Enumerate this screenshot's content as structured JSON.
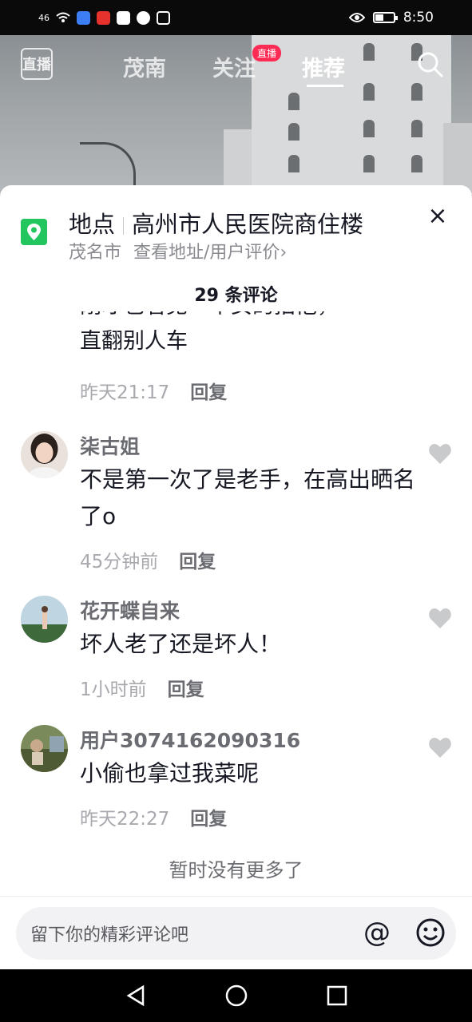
{
  "status_bar": {
    "signal": "46",
    "time": "8:50"
  },
  "top_nav": {
    "live_icon_label": "直播",
    "tabs": [
      {
        "label": "茂南"
      },
      {
        "label": "关注"
      },
      {
        "label": "推荐"
      }
    ],
    "live_badge": "直播"
  },
  "location": {
    "prefix": "地点",
    "name": "高州市人民医院商住楼",
    "city": "茂名市",
    "link": "查看地址/用户评价",
    "link_arrow": "›"
  },
  "comment_count": "29 条评论",
  "partial_comment": {
    "text_top": "刚才也看见一个女的拍他，",
    "text_bottom": "直翻别人车",
    "time": "昨天21:17",
    "reply": "回复"
  },
  "comments": [
    {
      "username": "柒古姐",
      "text": "不是第一次了是老手，在高出晒名了o",
      "time": "45分钟前",
      "reply": "回复"
    },
    {
      "username": "花开蝶自来",
      "text": "坏人老了还是坏人！",
      "time": "1小时前",
      "reply": "回复"
    },
    {
      "username": "用户3074162090316",
      "text": "小偷也拿过我菜呢",
      "time": "昨天22:27",
      "reply": "回复"
    }
  ],
  "no_more": "暂时没有更多了",
  "input": {
    "placeholder": "留下你的精彩评论吧",
    "at_symbol": "@"
  },
  "colors": {
    "accent": "#fe2c55",
    "pin_green": "#22c55e",
    "text_primary": "#161823",
    "text_secondary": "#a8a9ae"
  }
}
